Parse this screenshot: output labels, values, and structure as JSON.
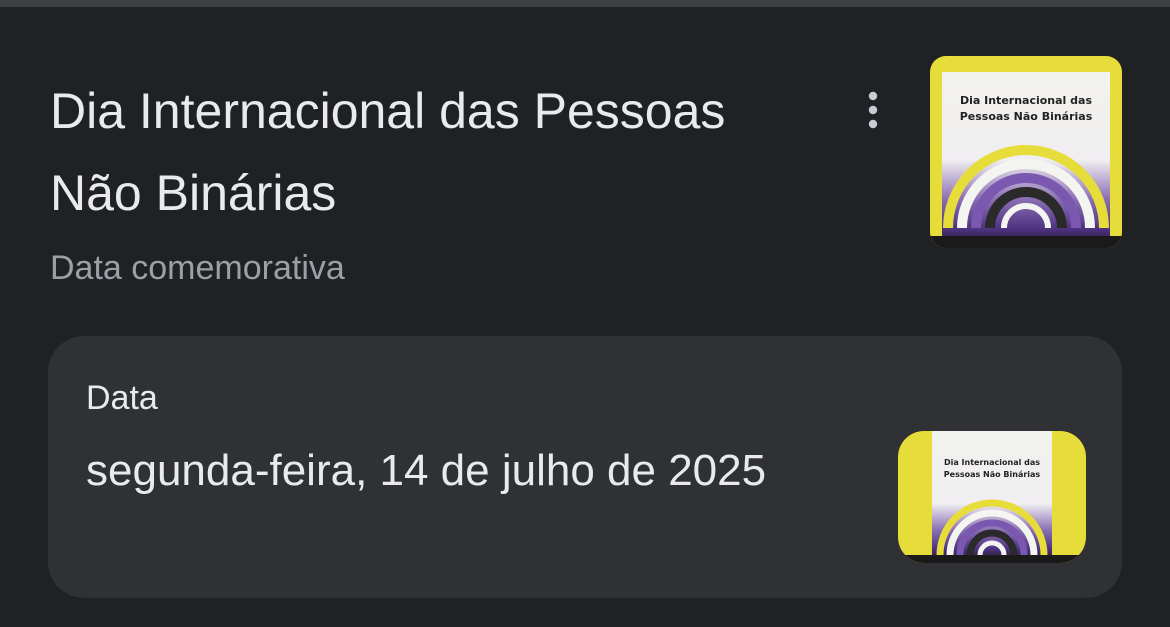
{
  "header": {
    "title": "Dia Internacional das Pessoas Não Binárias",
    "subtitle": "Data comemorativa",
    "more_icon": "more-vert-icon"
  },
  "thumbnail": {
    "poster_text_line1": "Dia Internacional das",
    "poster_text_line2": "Pessoas Não Binárias",
    "colors": {
      "yellow": "#e6dc3a",
      "white": "#f4f4f0",
      "purple": "#5b3f91",
      "black": "#1a1a1a"
    }
  },
  "date_card": {
    "label": "Data",
    "value": "segunda-feira, 14 de julho de 2025"
  },
  "colors": {
    "background": "#202124",
    "card": "#303134",
    "text_primary": "#e8eaed",
    "text_secondary": "#9aa0a6"
  }
}
